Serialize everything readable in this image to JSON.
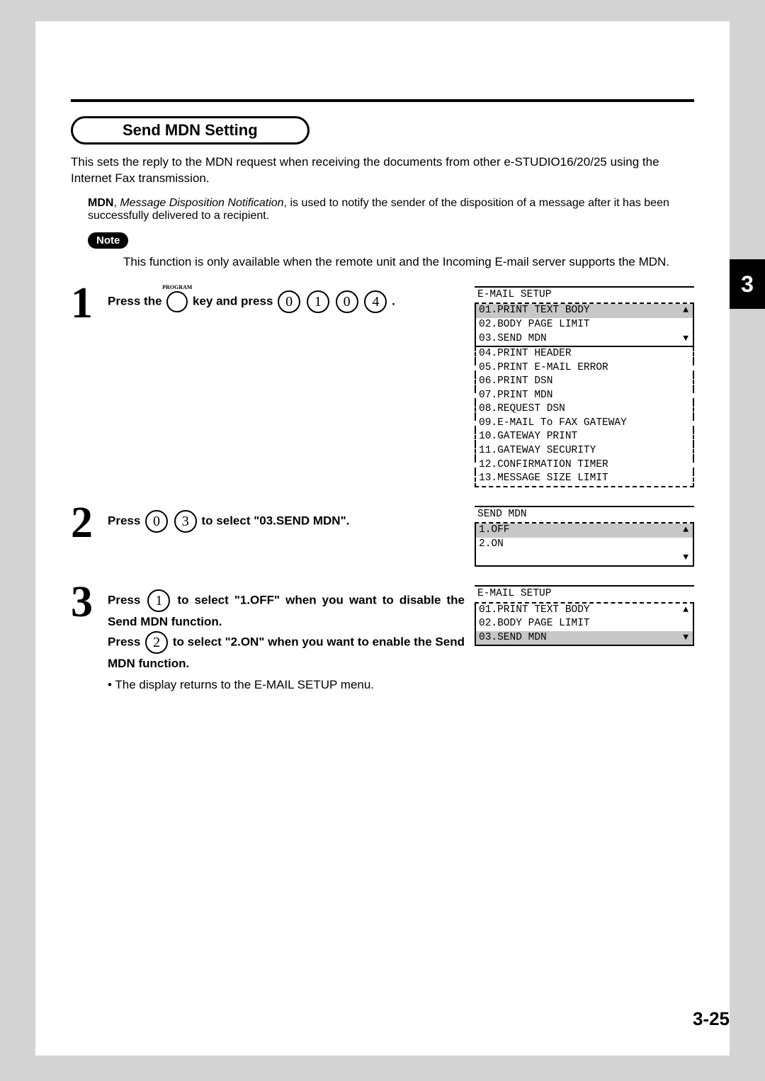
{
  "section_title": "Send MDN Setting",
  "intro": "This sets the reply to the MDN request when receiving the documents from other e-STUDIO16/20/25 using the Internet Fax transmission.",
  "mdn_def_prefix": "MDN",
  "mdn_def_em": "Message Disposition Notification",
  "mdn_def_rest": ", is used to notify the sender of the disposition of a message after it has been successfully delivered to a recipient.",
  "note_label": "Note",
  "note_text": "This function is only available when the remote unit and the Incoming E-mail server supports the MDN.",
  "side_tab": "3",
  "page_number": "3-25",
  "program_label": "PROGRAM",
  "steps": {
    "s1": {
      "num": "1",
      "t1": "Press the ",
      "t2": " key and press ",
      "keys": [
        "0",
        "1",
        "0",
        "4"
      ],
      "dot": "."
    },
    "s2": {
      "num": "2",
      "t1": "Press ",
      "keys": [
        "0",
        "3"
      ],
      "t2": " to select \"03.SEND MDN\"."
    },
    "s3": {
      "num": "3",
      "line1a": "Press ",
      "k1": "1",
      "line1b": " to select \"1.OFF\" when you want to disable the Send MDN function.",
      "line2a": "Press ",
      "k2": "2",
      "line2b": " to select \"2.ON\" when you want to enable the Send MDN function.",
      "bullet": "• The display returns to the E-MAIL SETUP menu."
    }
  },
  "lcd1": {
    "title": "E-MAIL SETUP",
    "items": [
      "01.PRINT TEXT BODY",
      "02.BODY PAGE LIMIT",
      "03.SEND MDN",
      "04.PRINT HEADER",
      "05.PRINT E-MAIL ERROR",
      "06.PRINT DSN",
      "07.PRINT MDN",
      "08.REQUEST DSN",
      "09.E-MAIL To FAX GATEWAY",
      "10.GATEWAY PRINT",
      "11.GATEWAY SECURITY",
      "12.CONFIRMATION TIMER",
      "13.MESSAGE SIZE LIMIT"
    ]
  },
  "lcd2": {
    "title": "SEND MDN",
    "items": [
      "1.OFF",
      "2.ON"
    ]
  },
  "lcd3": {
    "title": "E-MAIL SETUP",
    "items": [
      "01.PRINT TEXT BODY",
      "02.BODY PAGE LIMIT",
      "03.SEND MDN"
    ]
  }
}
